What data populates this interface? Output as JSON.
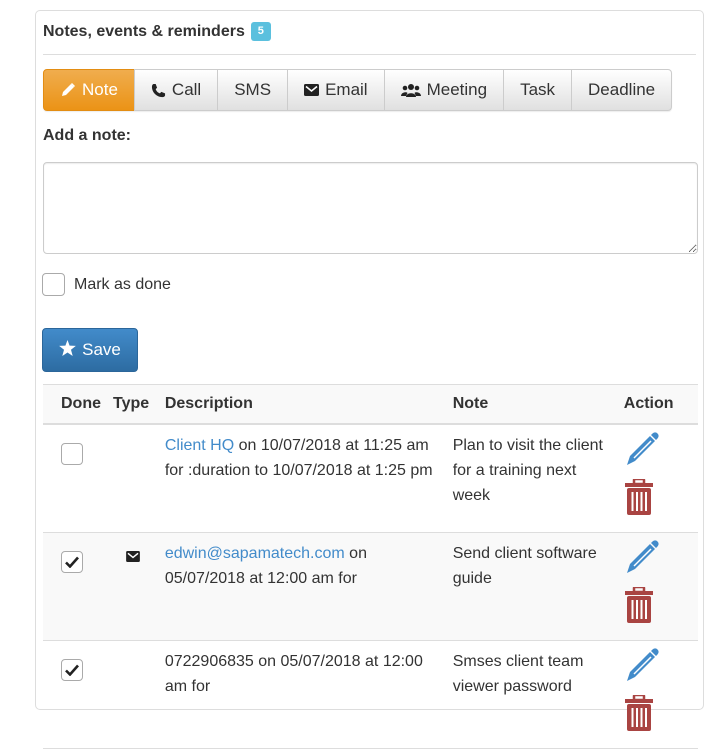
{
  "panel": {
    "title": "Notes, events & reminders",
    "badge_count": "5"
  },
  "tabs": [
    {
      "label": "Note",
      "icon": "pencil-icon",
      "active": true
    },
    {
      "label": "Call",
      "icon": "phone-icon",
      "active": false
    },
    {
      "label": "SMS",
      "icon": "",
      "active": false
    },
    {
      "label": "Email",
      "icon": "envelope-icon",
      "active": false
    },
    {
      "label": "Meeting",
      "icon": "users-icon",
      "active": false
    },
    {
      "label": "Task",
      "icon": "",
      "active": false
    },
    {
      "label": "Deadline",
      "icon": "",
      "active": false
    }
  ],
  "form": {
    "add_note_label": "Add a note:",
    "note_value": "",
    "note_placeholder": "",
    "mark_done_label": "Mark as done",
    "mark_done_checked": false,
    "save_label": "Save"
  },
  "table": {
    "headers": {
      "done": "Done",
      "type": "Type",
      "description": "Description",
      "note": "Note",
      "action": "Action"
    },
    "rows": [
      {
        "done": false,
        "type_icon": "",
        "desc_link": "Client HQ",
        "desc_text": " on 10/07/2018 at 11:25 am for :duration to 10/07/2018 at 1:25 pm",
        "note": "Plan to visit the client for a training next week"
      },
      {
        "done": true,
        "type_icon": "envelope-icon",
        "desc_link": "edwin@sapamatech.com",
        "desc_text": " on 05/07/2018 at 12:00 am for",
        "note": "Send client software guide"
      },
      {
        "done": true,
        "type_icon": "",
        "desc_link": "",
        "desc_text": "0722906835 on 05/07/2018 at 12:00 am for",
        "note": "Smses client team viewer password"
      }
    ]
  },
  "colors": {
    "active_tab": "#f0ad4e",
    "primary": "#428bca",
    "badge": "#5bc0de",
    "edit_icon": "#428bca",
    "delete_icon": "#a94442"
  }
}
